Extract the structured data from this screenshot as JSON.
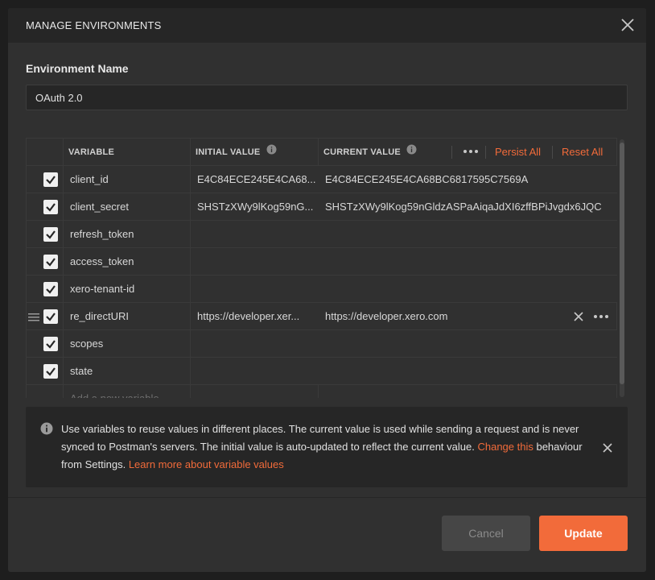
{
  "dialog": {
    "title": "MANAGE ENVIRONMENTS",
    "close_icon": "close-icon"
  },
  "environment": {
    "label": "Environment Name",
    "value": "OAuth 2.0"
  },
  "table": {
    "headers": {
      "variable": "VARIABLE",
      "initial_value": "INITIAL VALUE",
      "current_value": "CURRENT VALUE",
      "persist_all": "Persist All",
      "reset_all": "Reset All"
    },
    "rows": [
      {
        "checked": true,
        "variable": "client_id",
        "initial": "E4C84ECE245E4CA68...",
        "current": "E4C84ECE245E4CA68BC6817595C7569A"
      },
      {
        "checked": true,
        "variable": "client_secret",
        "initial": "SHSTzXWy9lKog59nG...",
        "current": "SHSTzXWy9lKog59nGldzASPaAiqaJdXI6zffBPiJvgdx6JQC"
      },
      {
        "checked": true,
        "variable": "refresh_token",
        "initial": "",
        "current": ""
      },
      {
        "checked": true,
        "variable": "access_token",
        "initial": "",
        "current": ""
      },
      {
        "checked": true,
        "variable": "xero-tenant-id",
        "initial": "",
        "current": ""
      },
      {
        "checked": true,
        "variable": "re_directURI",
        "initial": "https://developer.xer...",
        "current": "https://developer.xero.com"
      },
      {
        "checked": true,
        "variable": "scopes",
        "initial": "",
        "current": ""
      },
      {
        "checked": true,
        "variable": "state",
        "initial": "",
        "current": ""
      }
    ],
    "new_variable_placeholder": "Add a new variable"
  },
  "info": {
    "text_1": "Use variables to reuse values in different places. The current value is used while sending a request and is never synced to Postman's servers. The initial value is auto-updated to reflect the current value. ",
    "link_change": "Change this",
    "text_2": " behaviour from Settings. ",
    "link_learn": "Learn more about variable values"
  },
  "footer": {
    "cancel_label": "Cancel",
    "update_label": "Update"
  },
  "colors": {
    "accent": "#f26b3a",
    "background": "#303030",
    "header_bg": "#262626"
  }
}
